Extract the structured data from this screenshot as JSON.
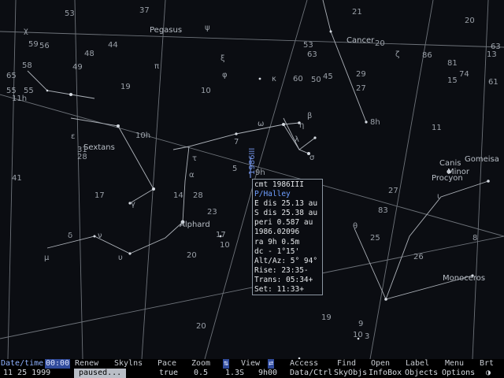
{
  "sky": {
    "constellations": [
      "Pegasus",
      "Cancer",
      "Sextans",
      "Alphard",
      "Canis",
      "Minor",
      "Gomeisa",
      "Procyon",
      "Monoceros"
    ],
    "comet_label": "1986III",
    "labels": [
      "53",
      "37",
      "59",
      "56",
      "48",
      "44",
      "49",
      "65",
      "58",
      "55",
      "11h",
      "19",
      "10",
      "60",
      "63",
      "50",
      "45",
      "29",
      "27",
      "20",
      "86",
      "81",
      "74",
      "63",
      "31",
      "10h",
      "28",
      "41",
      "17",
      "9h",
      "23",
      "28",
      "7",
      "5",
      "8h",
      "83",
      "14",
      "27",
      "25",
      "26",
      "20",
      "20",
      "10",
      "17",
      "19",
      "9",
      "3",
      "11",
      "8",
      "10",
      "20",
      "21",
      "15",
      "13",
      "55",
      "53",
      "61"
    ],
    "greek": [
      "χ",
      "ψ",
      "ξ",
      "φ",
      "ε",
      "κ",
      "ζ",
      "υ",
      "β",
      "δ",
      "ω",
      "σ",
      "τ",
      "α",
      "μ",
      "γ",
      "θ",
      "η",
      "ι",
      "λ",
      "ν",
      "π"
    ]
  },
  "infobox": {
    "lines": [
      "cmt 1986III",
      "P/Halley",
      "E dis 25.13 au",
      "S dis 25.38 au",
      "peri 0.587 au",
      "  1986.02096",
      "ra  9h 0.5m",
      "dc - 1°15'",
      "Alt/Az:  5° 94°",
      "Rise:   23:35-",
      "Trans:  05:34+",
      "Set:    11:33+"
    ]
  },
  "menu": {
    "datetime": "Date/time",
    "time_field": "00:00",
    "items": [
      "Renew",
      "Skylns",
      "Pace",
      "Zoom",
      "View",
      "Access",
      "Find",
      "Open",
      "Label",
      "Menu",
      "Brt"
    ],
    "zoom_marker": "⇅",
    "view_marker": "⇄"
  },
  "status": {
    "date": "11 25 1999",
    "paused": "paused...",
    "flag": "true",
    "pace": "0.5",
    "zoom": "1.3S",
    "ra": "9h00",
    "panes": [
      "Data/Ctrl",
      "SkyObjs",
      "InfoBox",
      "Objects",
      "Options"
    ],
    "end_icon": "◑"
  }
}
